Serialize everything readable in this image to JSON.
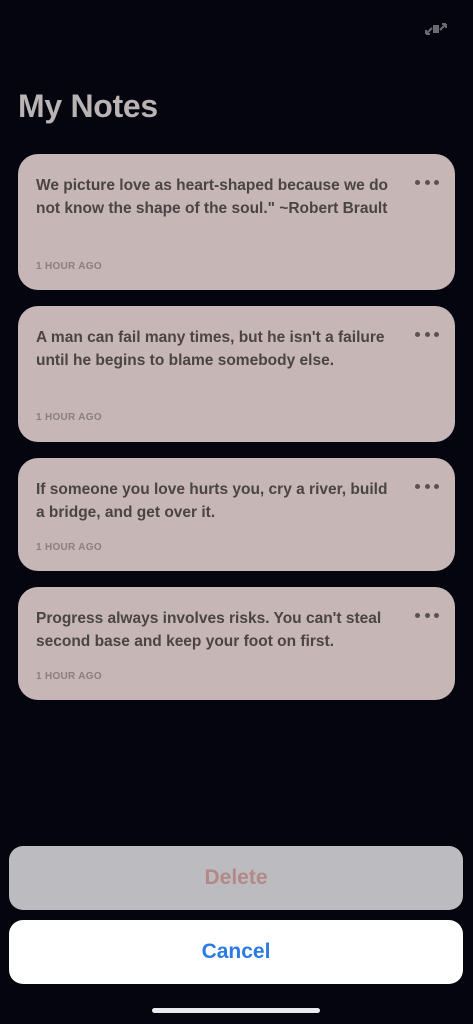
{
  "header": {
    "title": "My Notes",
    "expand_icon": "expand-arrows-icon"
  },
  "notes": [
    {
      "text": "We picture love as heart-shaped because we do not know the shape of the soul.\" ~Robert Brault",
      "time": "1 HOUR AGO"
    },
    {
      "text": "A man can fail many times, but he isn't a failure until he begins to blame somebody else.",
      "time": "1 HOUR AGO"
    },
    {
      "text": "If someone you love hurts you, cry a river, build a bridge, and get over it.",
      "time": "1 HOUR AGO"
    },
    {
      "text": "Progress always involves risks. You can't steal second base and keep your foot on first.",
      "time": "1 HOUR AGO"
    }
  ],
  "action_sheet": {
    "delete_label": "Delete",
    "cancel_label": "Cancel"
  },
  "colors": {
    "background": "#05050f",
    "card": "#c7b6b6",
    "accent_blue": "#2a7be4",
    "delete_text": "#b28888"
  }
}
